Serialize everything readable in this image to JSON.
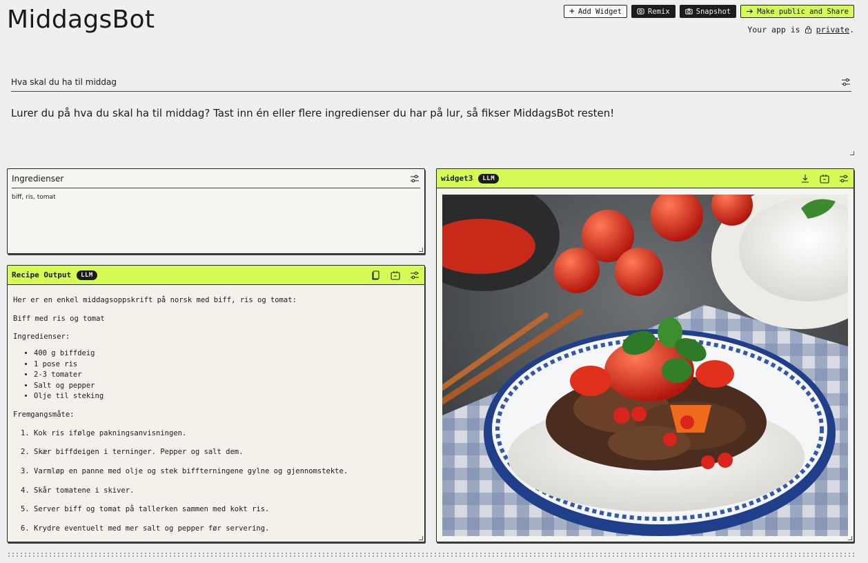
{
  "app": {
    "title": "MiddagsBot",
    "visibility_prefix": "Your app is",
    "visibility_value": "private",
    "visibility_suffix": "."
  },
  "toolbar": {
    "add_widget": "Add Widget",
    "remix": "Remix",
    "snapshot": "Snapshot",
    "make_public": "Make public and Share"
  },
  "intro": {
    "label": "Hva skal du ha til middag",
    "text": "Lurer du på hva du skal ha til middag? Tast inn én eller flere ingredienser du har på lur, så fikser MiddagsBot resten!"
  },
  "ingredients": {
    "label": "Ingredienser",
    "value": "biff, ris, tomat"
  },
  "recipe": {
    "title": "Recipe Output",
    "badge": "LLM",
    "intro": "Her er en enkel middagsoppskrift på norsk med biff, ris og tomat:",
    "dish": "Biff med ris og tomat",
    "ingredients_heading": "Ingredienser:",
    "ingredients": [
      "400 g biffdeig",
      "1 pose ris",
      "2-3 tomater",
      "Salt og pepper",
      "Olje til steking"
    ],
    "method_heading": "Fremgangsmåte:",
    "steps": [
      "Kok ris ifølge pakningsanvisningen.",
      "Skær biffdeigen i terninger. Pepper og salt dem.",
      "Varmløp en panne med olje og stek biffterningene gylne og gjennomstekte.",
      "Skår tomatene i skiver.",
      "Server biff og tomat på tallerken sammen med kokt ris.",
      "Krydre eventuelt med mer salt og pepper før servering."
    ]
  },
  "image_widget": {
    "title": "widget3",
    "badge": "LLM"
  },
  "colors": {
    "accent": "#d7fb55",
    "background": "#efefef",
    "dark": "#1c1c1c"
  }
}
